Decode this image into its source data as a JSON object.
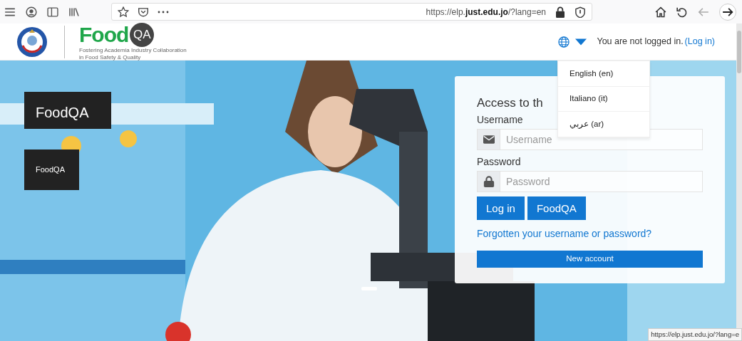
{
  "browser": {
    "url": "https://elp.**just.edu.jo**/?lang=en",
    "status_url": "https://elp.just.edu.jo/?lang=e"
  },
  "header": {
    "logo_text": "Food",
    "logo_badge": "QA",
    "tagline": [
      "Fostering Academia Industry Collaboration",
      "in Food Safety & Quality"
    ],
    "login_status": "You are not logged in.",
    "login_link": "(Log in)"
  },
  "language_menu": {
    "expanded": true,
    "items": [
      {
        "label": "English (en)"
      },
      {
        "label": "Italiano (it)"
      },
      {
        "label": "عربي (ar)"
      }
    ]
  },
  "slide": {
    "title": "FoodQA",
    "caption": "FoodQA"
  },
  "login": {
    "title": "Access to th",
    "username_label": "Username",
    "username_placeholder": "Username",
    "password_label": "Password",
    "password_placeholder": "Password",
    "buttons": [
      "Log in",
      "FoodQA"
    ],
    "forgot_link": "Forgotten your username or password?",
    "new_account": "New account"
  }
}
